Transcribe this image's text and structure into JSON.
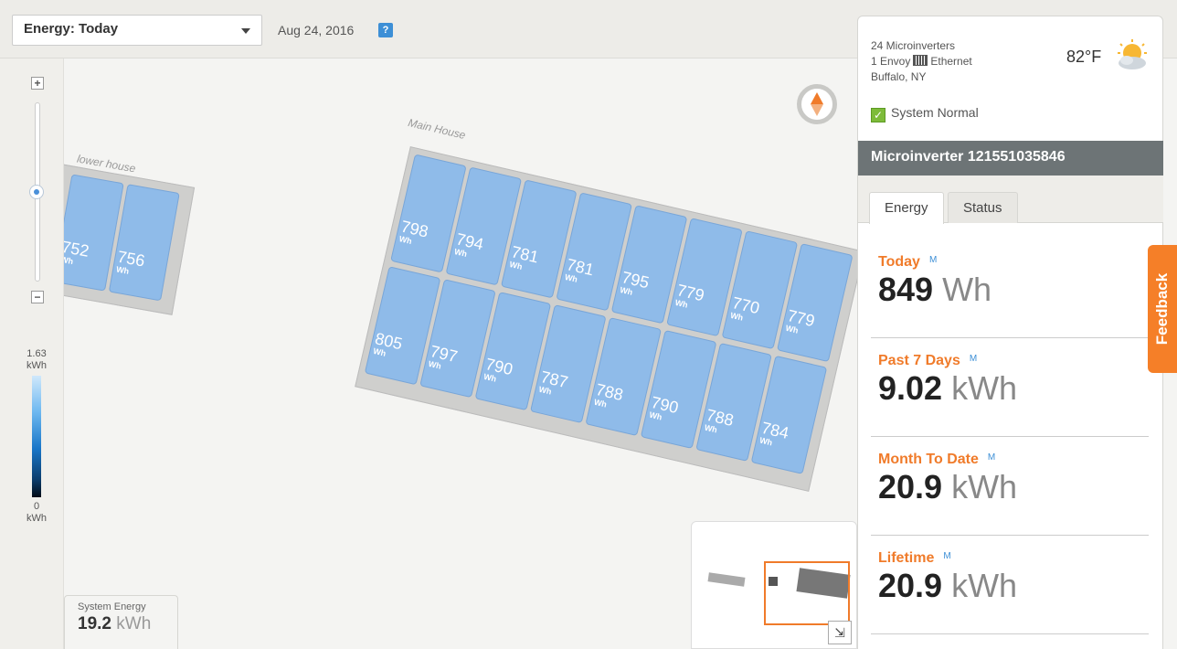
{
  "toolbar": {
    "view_label": "Energy: Today",
    "date": "Aug 24, 2016",
    "help": "?"
  },
  "legend": {
    "max_value": "1.63",
    "max_unit": "kWh",
    "min_value": "0",
    "min_unit": "kWh"
  },
  "arrays": {
    "lower_house": {
      "label": "lower house",
      "panels": [
        "752",
        "756"
      ]
    },
    "main_house": {
      "label": "Main House",
      "top_row": [
        "798",
        "794",
        "781",
        "781",
        "795",
        "779",
        "770",
        "779"
      ],
      "bottom_row": [
        "805",
        "797",
        "790",
        "787",
        "788",
        "790",
        "788",
        "784"
      ]
    },
    "panel_unit": "Wh"
  },
  "system_energy": {
    "label": "System Energy",
    "value": "19.2",
    "unit": "kWh"
  },
  "side": {
    "microinverters": "24 Microinverters",
    "envoy_prefix": "1 Envoy",
    "envoy_conn": "Ethernet",
    "location": "Buffalo, NY",
    "temperature": "82°F",
    "status": "System Normal",
    "microinverter_title": "Microinverter 121551035846",
    "tabs": [
      "Energy",
      "Status"
    ],
    "marker": "M",
    "stats": [
      {
        "title": "Today",
        "value": "849",
        "unit": "Wh"
      },
      {
        "title": "Past 7 Days",
        "value": "9.02",
        "unit": "kWh"
      },
      {
        "title": "Month To Date",
        "value": "20.9",
        "unit": "kWh"
      },
      {
        "title": "Lifetime",
        "value": "20.9",
        "unit": "kWh"
      }
    ]
  },
  "feedback_label": "Feedback",
  "icons": {
    "compass": "compass-icon",
    "weather": "partly-cloudy-icon",
    "status": "check-icon"
  },
  "colors": {
    "accent": "#f07b2a",
    "panel": "#8fbbe9",
    "status_green": "#7dbb3a"
  }
}
